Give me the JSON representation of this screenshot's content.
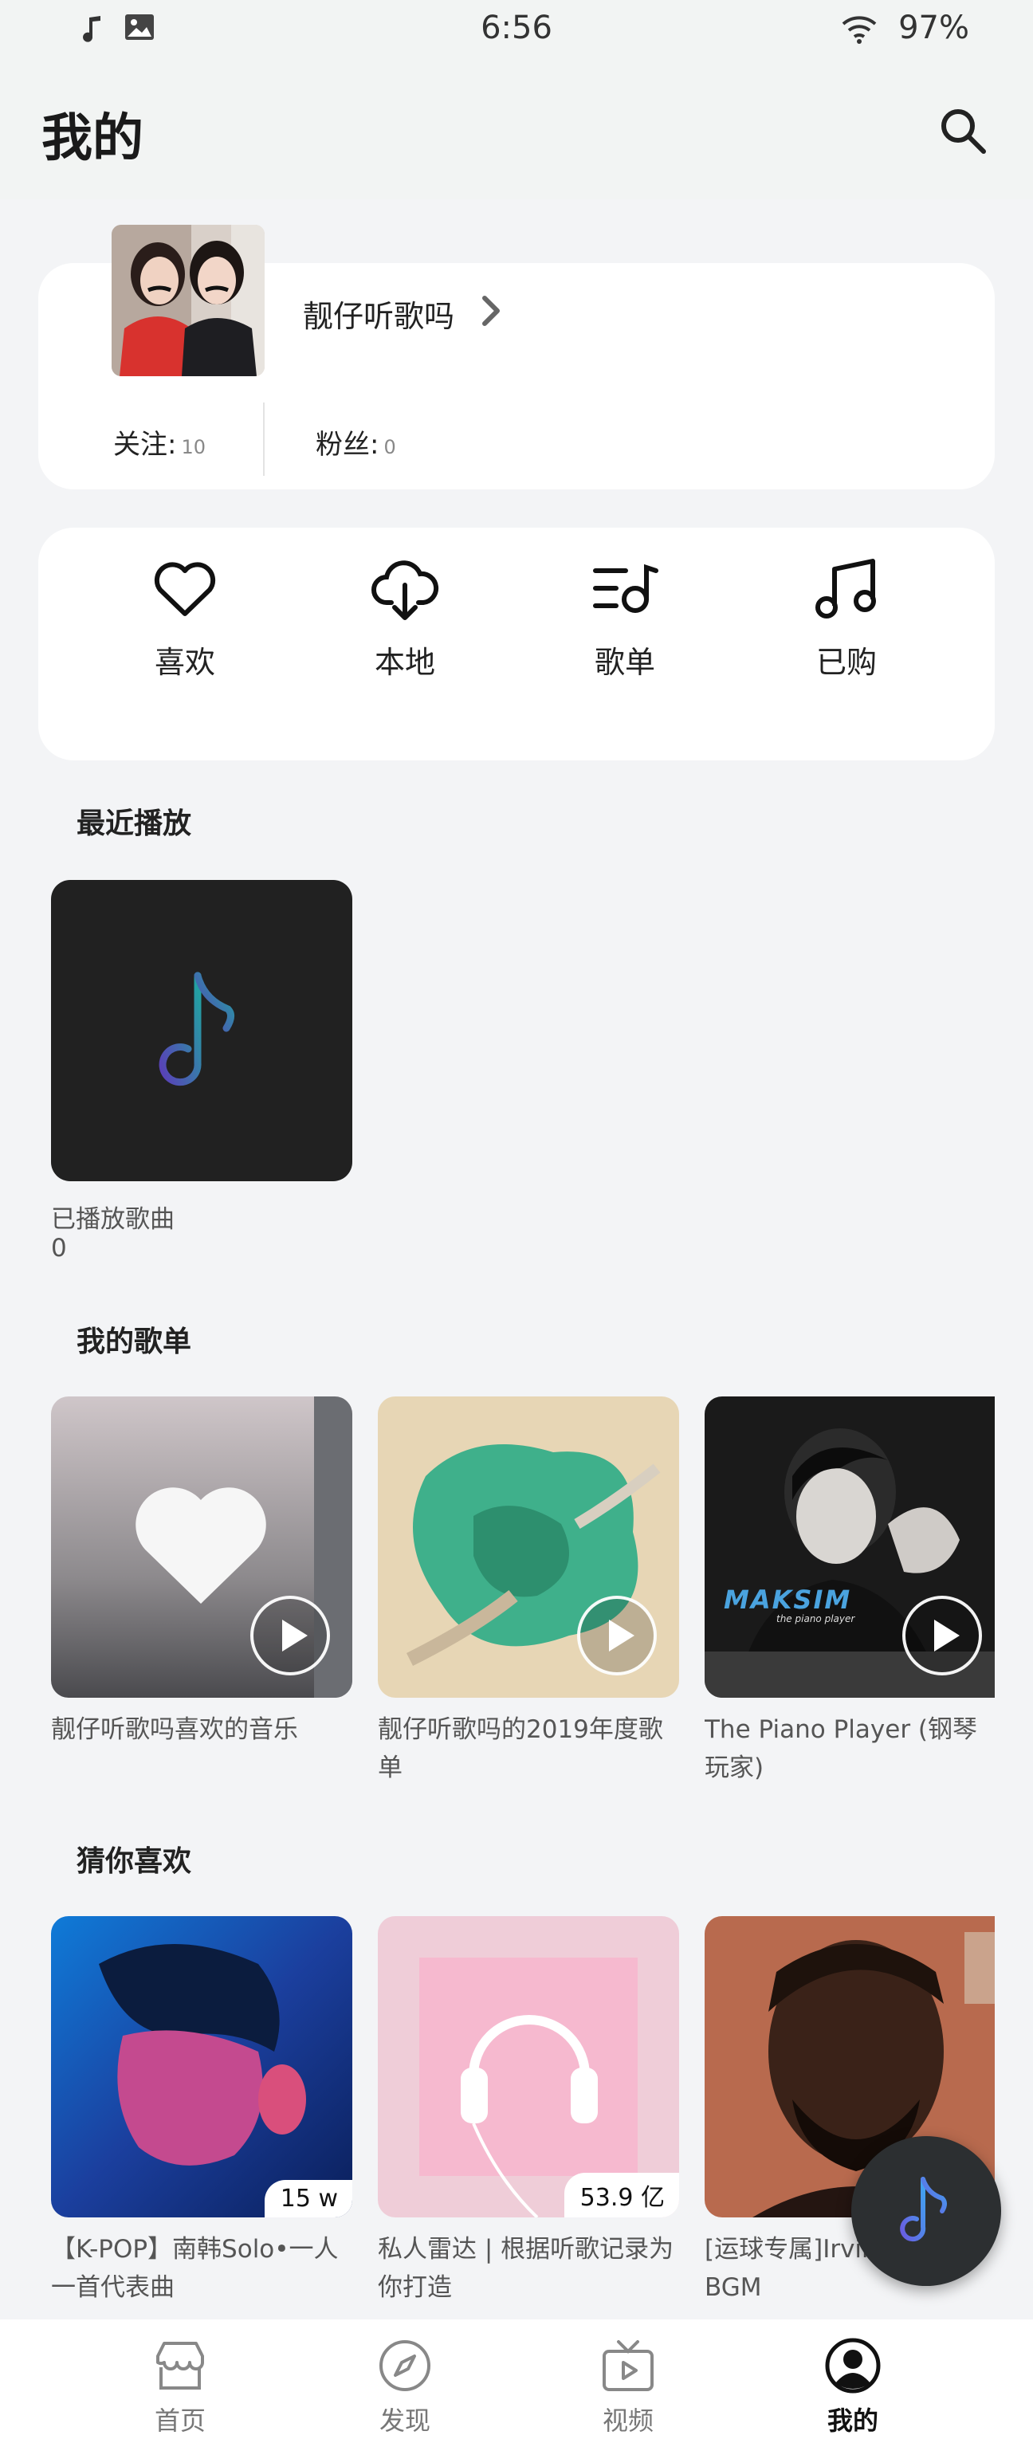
{
  "status_bar": {
    "time": "6:56",
    "battery": "97%",
    "icons": [
      "music-note-icon",
      "image-icon",
      "wifi-icon"
    ]
  },
  "header": {
    "title": "我的",
    "search_icon": "search-icon"
  },
  "profile": {
    "username": "靓仔听歌吗",
    "following_label": "关注:",
    "following_count": "10",
    "followers_label": "粉丝:",
    "followers_count": "0"
  },
  "quick_actions": [
    {
      "label": "喜欢",
      "icon": "heart-icon"
    },
    {
      "label": "本地",
      "icon": "cloud-download-icon"
    },
    {
      "label": "歌单",
      "icon": "playlist-icon"
    },
    {
      "label": "已购",
      "icon": "music-notes-icon"
    }
  ],
  "recent": {
    "title": "最近播放",
    "item_name": "已播放歌曲",
    "item_count": "0"
  },
  "my_playlists": {
    "title": "我的歌单",
    "items": [
      {
        "title": "靓仔听歌吗喜欢的音乐"
      },
      {
        "title": "靓仔听歌吗的2019年度歌单"
      },
      {
        "title": "The Piano Player (钢琴玩家)",
        "cover_text": "MAKSIM",
        "cover_subtext": "the piano player"
      }
    ]
  },
  "recommend": {
    "title": "猜你喜欢",
    "items": [
      {
        "title": "【K-POP】南韩Solo•一人一首代表曲",
        "count": "15 w"
      },
      {
        "title": "私人雷达 | 根据听歌记录为你打造",
        "count": "53.9 亿"
      },
      {
        "title": "[运球专属]Irving训练BGM"
      }
    ]
  },
  "bottom_nav": [
    {
      "label": "首页",
      "icon": "home-icon",
      "active": false
    },
    {
      "label": "发现",
      "icon": "compass-icon",
      "active": false
    },
    {
      "label": "视频",
      "icon": "video-icon",
      "active": false
    },
    {
      "label": "我的",
      "icon": "profile-icon",
      "active": true
    }
  ],
  "colors": {
    "background": "#f3f4f6",
    "card": "#ffffff",
    "accent": "#3b82f6",
    "fab": "#2c2f31"
  }
}
